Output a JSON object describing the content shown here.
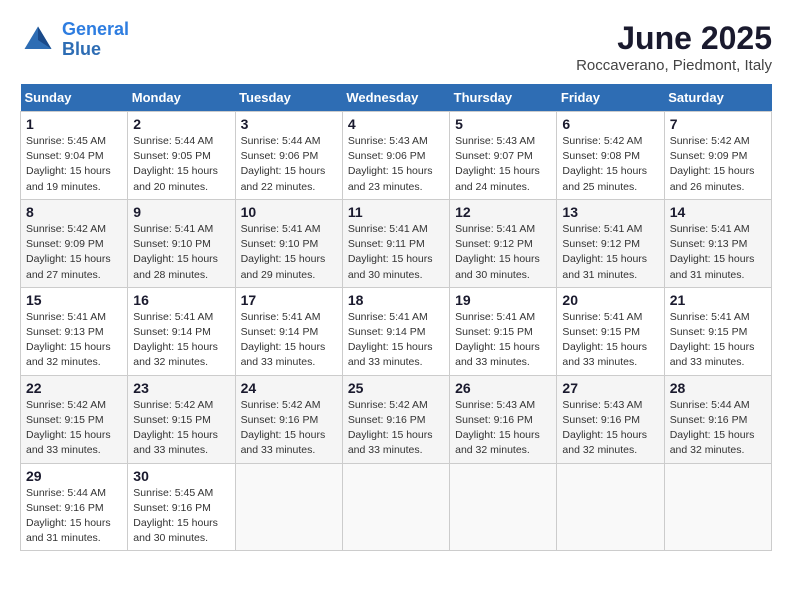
{
  "header": {
    "logo_line1": "General",
    "logo_line2": "Blue",
    "title": "June 2025",
    "subtitle": "Roccaverano, Piedmont, Italy"
  },
  "weekdays": [
    "Sunday",
    "Monday",
    "Tuesday",
    "Wednesday",
    "Thursday",
    "Friday",
    "Saturday"
  ],
  "weeks": [
    [
      {
        "day": "1",
        "sunrise": "5:45 AM",
        "sunset": "9:04 PM",
        "daylight": "15 hours and 19 minutes."
      },
      {
        "day": "2",
        "sunrise": "5:44 AM",
        "sunset": "9:05 PM",
        "daylight": "15 hours and 20 minutes."
      },
      {
        "day": "3",
        "sunrise": "5:44 AM",
        "sunset": "9:06 PM",
        "daylight": "15 hours and 22 minutes."
      },
      {
        "day": "4",
        "sunrise": "5:43 AM",
        "sunset": "9:06 PM",
        "daylight": "15 hours and 23 minutes."
      },
      {
        "day": "5",
        "sunrise": "5:43 AM",
        "sunset": "9:07 PM",
        "daylight": "15 hours and 24 minutes."
      },
      {
        "day": "6",
        "sunrise": "5:42 AM",
        "sunset": "9:08 PM",
        "daylight": "15 hours and 25 minutes."
      },
      {
        "day": "7",
        "sunrise": "5:42 AM",
        "sunset": "9:09 PM",
        "daylight": "15 hours and 26 minutes."
      }
    ],
    [
      {
        "day": "8",
        "sunrise": "5:42 AM",
        "sunset": "9:09 PM",
        "daylight": "15 hours and 27 minutes."
      },
      {
        "day": "9",
        "sunrise": "5:41 AM",
        "sunset": "9:10 PM",
        "daylight": "15 hours and 28 minutes."
      },
      {
        "day": "10",
        "sunrise": "5:41 AM",
        "sunset": "9:10 PM",
        "daylight": "15 hours and 29 minutes."
      },
      {
        "day": "11",
        "sunrise": "5:41 AM",
        "sunset": "9:11 PM",
        "daylight": "15 hours and 30 minutes."
      },
      {
        "day": "12",
        "sunrise": "5:41 AM",
        "sunset": "9:12 PM",
        "daylight": "15 hours and 30 minutes."
      },
      {
        "day": "13",
        "sunrise": "5:41 AM",
        "sunset": "9:12 PM",
        "daylight": "15 hours and 31 minutes."
      },
      {
        "day": "14",
        "sunrise": "5:41 AM",
        "sunset": "9:13 PM",
        "daylight": "15 hours and 31 minutes."
      }
    ],
    [
      {
        "day": "15",
        "sunrise": "5:41 AM",
        "sunset": "9:13 PM",
        "daylight": "15 hours and 32 minutes."
      },
      {
        "day": "16",
        "sunrise": "5:41 AM",
        "sunset": "9:14 PM",
        "daylight": "15 hours and 32 minutes."
      },
      {
        "day": "17",
        "sunrise": "5:41 AM",
        "sunset": "9:14 PM",
        "daylight": "15 hours and 33 minutes."
      },
      {
        "day": "18",
        "sunrise": "5:41 AM",
        "sunset": "9:14 PM",
        "daylight": "15 hours and 33 minutes."
      },
      {
        "day": "19",
        "sunrise": "5:41 AM",
        "sunset": "9:15 PM",
        "daylight": "15 hours and 33 minutes."
      },
      {
        "day": "20",
        "sunrise": "5:41 AM",
        "sunset": "9:15 PM",
        "daylight": "15 hours and 33 minutes."
      },
      {
        "day": "21",
        "sunrise": "5:41 AM",
        "sunset": "9:15 PM",
        "daylight": "15 hours and 33 minutes."
      }
    ],
    [
      {
        "day": "22",
        "sunrise": "5:42 AM",
        "sunset": "9:15 PM",
        "daylight": "15 hours and 33 minutes."
      },
      {
        "day": "23",
        "sunrise": "5:42 AM",
        "sunset": "9:15 PM",
        "daylight": "15 hours and 33 minutes."
      },
      {
        "day": "24",
        "sunrise": "5:42 AM",
        "sunset": "9:16 PM",
        "daylight": "15 hours and 33 minutes."
      },
      {
        "day": "25",
        "sunrise": "5:42 AM",
        "sunset": "9:16 PM",
        "daylight": "15 hours and 33 minutes."
      },
      {
        "day": "26",
        "sunrise": "5:43 AM",
        "sunset": "9:16 PM",
        "daylight": "15 hours and 32 minutes."
      },
      {
        "day": "27",
        "sunrise": "5:43 AM",
        "sunset": "9:16 PM",
        "daylight": "15 hours and 32 minutes."
      },
      {
        "day": "28",
        "sunrise": "5:44 AM",
        "sunset": "9:16 PM",
        "daylight": "15 hours and 32 minutes."
      }
    ],
    [
      {
        "day": "29",
        "sunrise": "5:44 AM",
        "sunset": "9:16 PM",
        "daylight": "15 hours and 31 minutes."
      },
      {
        "day": "30",
        "sunrise": "5:45 AM",
        "sunset": "9:16 PM",
        "daylight": "15 hours and 30 minutes."
      },
      null,
      null,
      null,
      null,
      null
    ]
  ]
}
